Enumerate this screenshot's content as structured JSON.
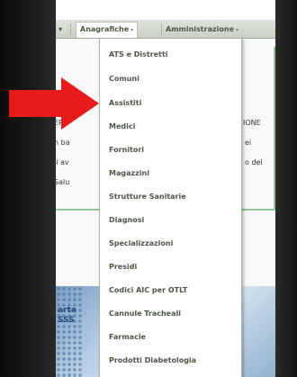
{
  "navbar": {
    "left_caret": "▾",
    "anagrafiche_label": "Anagrafiche",
    "anagrafiche_caret": "▾",
    "admin_label": "Amministrazione",
    "admin_caret": "▾"
  },
  "content": {
    "frag1": "ER I",
    "frag2": "n ba",
    "frag3": "li av",
    "frag4": "Salu",
    "frag5": "IONE",
    "frag6": "ei",
    "frag7": "o del"
  },
  "photo": {
    "text_line1": "arta",
    "text_line2": "SSS"
  },
  "dropdown": {
    "items": [
      {
        "label": "ATS e Distretti"
      },
      {
        "label": "Comuni"
      },
      {
        "label": "Assistiti"
      },
      {
        "label": "Medici"
      },
      {
        "label": "Fornitori"
      },
      {
        "label": "Magazzini"
      },
      {
        "label": "Strutture Sanitarie"
      },
      {
        "label": "Diagnosi"
      },
      {
        "label": "Specializzazioni"
      },
      {
        "label": "Presidi"
      },
      {
        "label": "Codici AIC per OTLT"
      },
      {
        "label": "Cannule Tracheali"
      },
      {
        "label": "Farmacie"
      },
      {
        "label": "Prodotti Diabetologia"
      }
    ]
  },
  "colors": {
    "arrow": "#e81b1b",
    "panel_border": "#8fc59a",
    "menu_text": "#4b5646"
  },
  "icons": {
    "pointer_arrow": "red-arrow-icon"
  }
}
